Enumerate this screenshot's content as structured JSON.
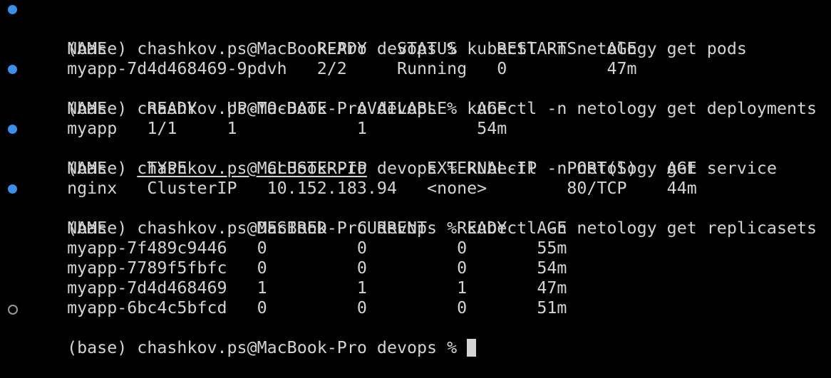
{
  "colors": {
    "background": "#000000",
    "text": "#d4d4d4",
    "success_dot": "#3b8eea",
    "pending_dot": "#9a9a9a"
  },
  "lines": [
    {
      "kind": "command",
      "status": "success",
      "text": "(base) chashkov.ps@MacBook-Pro devops % kubectl -n netology get pods"
    },
    {
      "kind": "output",
      "text": "NAME                     READY   STATUS    RESTARTS   AGE"
    },
    {
      "kind": "output",
      "text": "myapp-7d4d468469-9pdvh   2/2     Running   0          47m"
    },
    {
      "kind": "command",
      "status": "success",
      "text": "(base) chashkov.ps@MacBook-Pro devops % kubectl -n netology get deployments"
    },
    {
      "kind": "output",
      "text": "NAME    READY   UP-TO-DATE   AVAILABLE   AGE"
    },
    {
      "kind": "output",
      "text": "myapp   1/1     1            1           54m"
    },
    {
      "kind": "command_underlined",
      "status": "success",
      "prefix": "(base) ",
      "underlined": "chashkov.ps@MacBook-Pro",
      "suffix": " devops % kubectl -n netology get service"
    },
    {
      "kind": "output",
      "text": "NAME    TYPE        CLUSTER-IP      EXTERNAL-IP   PORT(S)   AGE"
    },
    {
      "kind": "output",
      "text": "nginx   ClusterIP   10.152.183.94   <none>        80/TCP    44m"
    },
    {
      "kind": "command",
      "status": "success",
      "text": "(base) chashkov.ps@MacBook-Pro devops % kubectl -n netology get replicasets"
    },
    {
      "kind": "output",
      "text": "NAME               DESIRED   CURRENT   READY   AGE"
    },
    {
      "kind": "output",
      "text": "myapp-7f489c9446   0         0         0       55m"
    },
    {
      "kind": "output",
      "text": "myapp-7789f5fbfc   0         0         0       54m"
    },
    {
      "kind": "output",
      "text": "myapp-7d4d468469   1         1         1       47m"
    },
    {
      "kind": "output",
      "text": "myapp-6bc4c5bfcd   0         0         0       51m"
    },
    {
      "kind": "prompt",
      "status": "pending",
      "text": "(base) chashkov.ps@MacBook-Pro devops % "
    }
  ]
}
